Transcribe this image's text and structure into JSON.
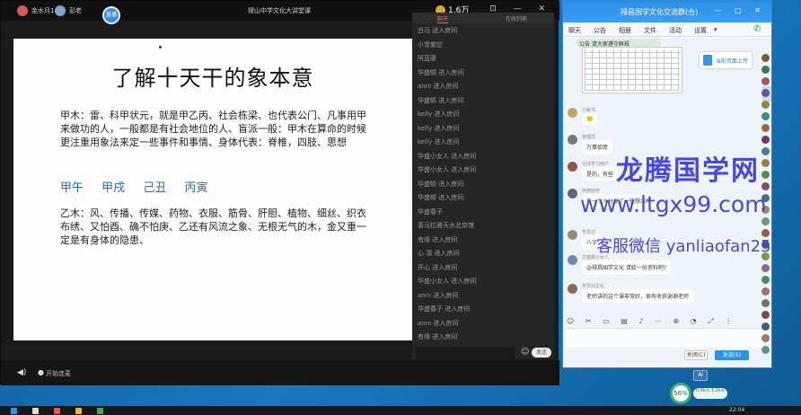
{
  "live": {
    "title": "禄山中学文化大讲堂课",
    "host_name": "金水月1",
    "host_name2": "彭老",
    "center_label": "直播",
    "user_label": "1.6万",
    "window_controls": "⊡ — ✕",
    "bottom": {
      "speaker_icon": "speaker-icon",
      "mic_label": "开始连麦"
    }
  },
  "slide": {
    "title": "了解十天干的象本意",
    "para1": "甲木：雷、科甲状元，就是甲乙丙、社会栋梁、也代表公门、凡事用甲来做功的人，一般都是有社会地位的人、盲派一般：甲木在算命的时候更注重用象法来定一些事件和事情、身体代表：脊椎，四肢、思想",
    "ganzhi": [
      "甲午",
      "甲戌",
      "己丑",
      "丙寅"
    ],
    "para2": "乙木：风、传播、传媒、药物、衣服、筋骨、肝胆、植物、细丝、织衣布绣、又怕酉、确不怕庚、乙还有风流之象、无根无气的木，金又重一定是有身体的隐患、"
  },
  "chat": {
    "tabs": [
      "聊天",
      "在线列表"
    ],
    "messages": [
      "白马 进入房间",
      "小雪紫空",
      "阿蓝藤",
      "华盛顿 进入房间",
      "anni 进入房间",
      "华盛顿 进入房间",
      "kelly 进入房间",
      "kelly 进入房间",
      "kelly 进入房间",
      "华盛小女人 进入房间",
      "华盛小女人 进入房间",
      "华盛顿 进入房间",
      "华盛顿 进入房间",
      "华盛春子",
      "喜马拉雅天水北京馆",
      "有缘 进入房间",
      "心 凛 进入房间",
      "开心 进入房间",
      "华盛小女人 进入房间",
      "anni 进入房间",
      "华盛春子 进入房间",
      "anni 进入房间",
      "有缘 进入房间",
      "华盛小女人 进入房间"
    ],
    "send_label": "发送",
    "emoji_icon": "emoji-icon"
  },
  "qq": {
    "title": "禄昌国学文化交流群(合)",
    "window_controls": "— ▢ ✕",
    "tabs": [
      "聊天",
      "公告",
      "相册",
      "文件",
      "活动",
      "设置"
    ],
    "tab_more": "▾",
    "subbar": "公告 群主发了新群公告",
    "announcement": "公告 请大家遵守群规",
    "file_label": "当前页面上传",
    "messages": [
      {
        "nick": "小秘书",
        "text": "🙂"
      },
      {
        "nick": "管理员",
        "text": "万事如意"
      },
      {
        "nick": "在线学习用户",
        "text": "是的，有些"
      },
      {
        "nick": "阿德韵学",
        "text": "有一个人分享了一些想法吗"
      },
      {
        "nick": "学员刘",
        "text": "八字"
      },
      {
        "nick": "华盛顿小女人",
        "text": "@禄昌国学文化 请给一份资料吧?"
      },
      {
        "nick": "学员刘文化",
        "text": "老师讲的这个课非常好，很有收获谢谢老师"
      }
    ],
    "toolbar": "☺ ✂ ▭ ▤ ♪ ⋯   ⊕ ◔ ⤢ ⋮",
    "close_label": "关闭(C)",
    "send_label": "发送(S)",
    "collapse": "‹"
  },
  "watermark": {
    "brand": "龙腾国学网",
    "url": "www.ltgx99.com",
    "wechat": "客服微信 yanliaofan25"
  },
  "status": {
    "ai_label": "AI",
    "percent": "56%",
    "net": "0.6k/s 1.2k/s"
  },
  "taskbar": {
    "clock": "22:04"
  }
}
